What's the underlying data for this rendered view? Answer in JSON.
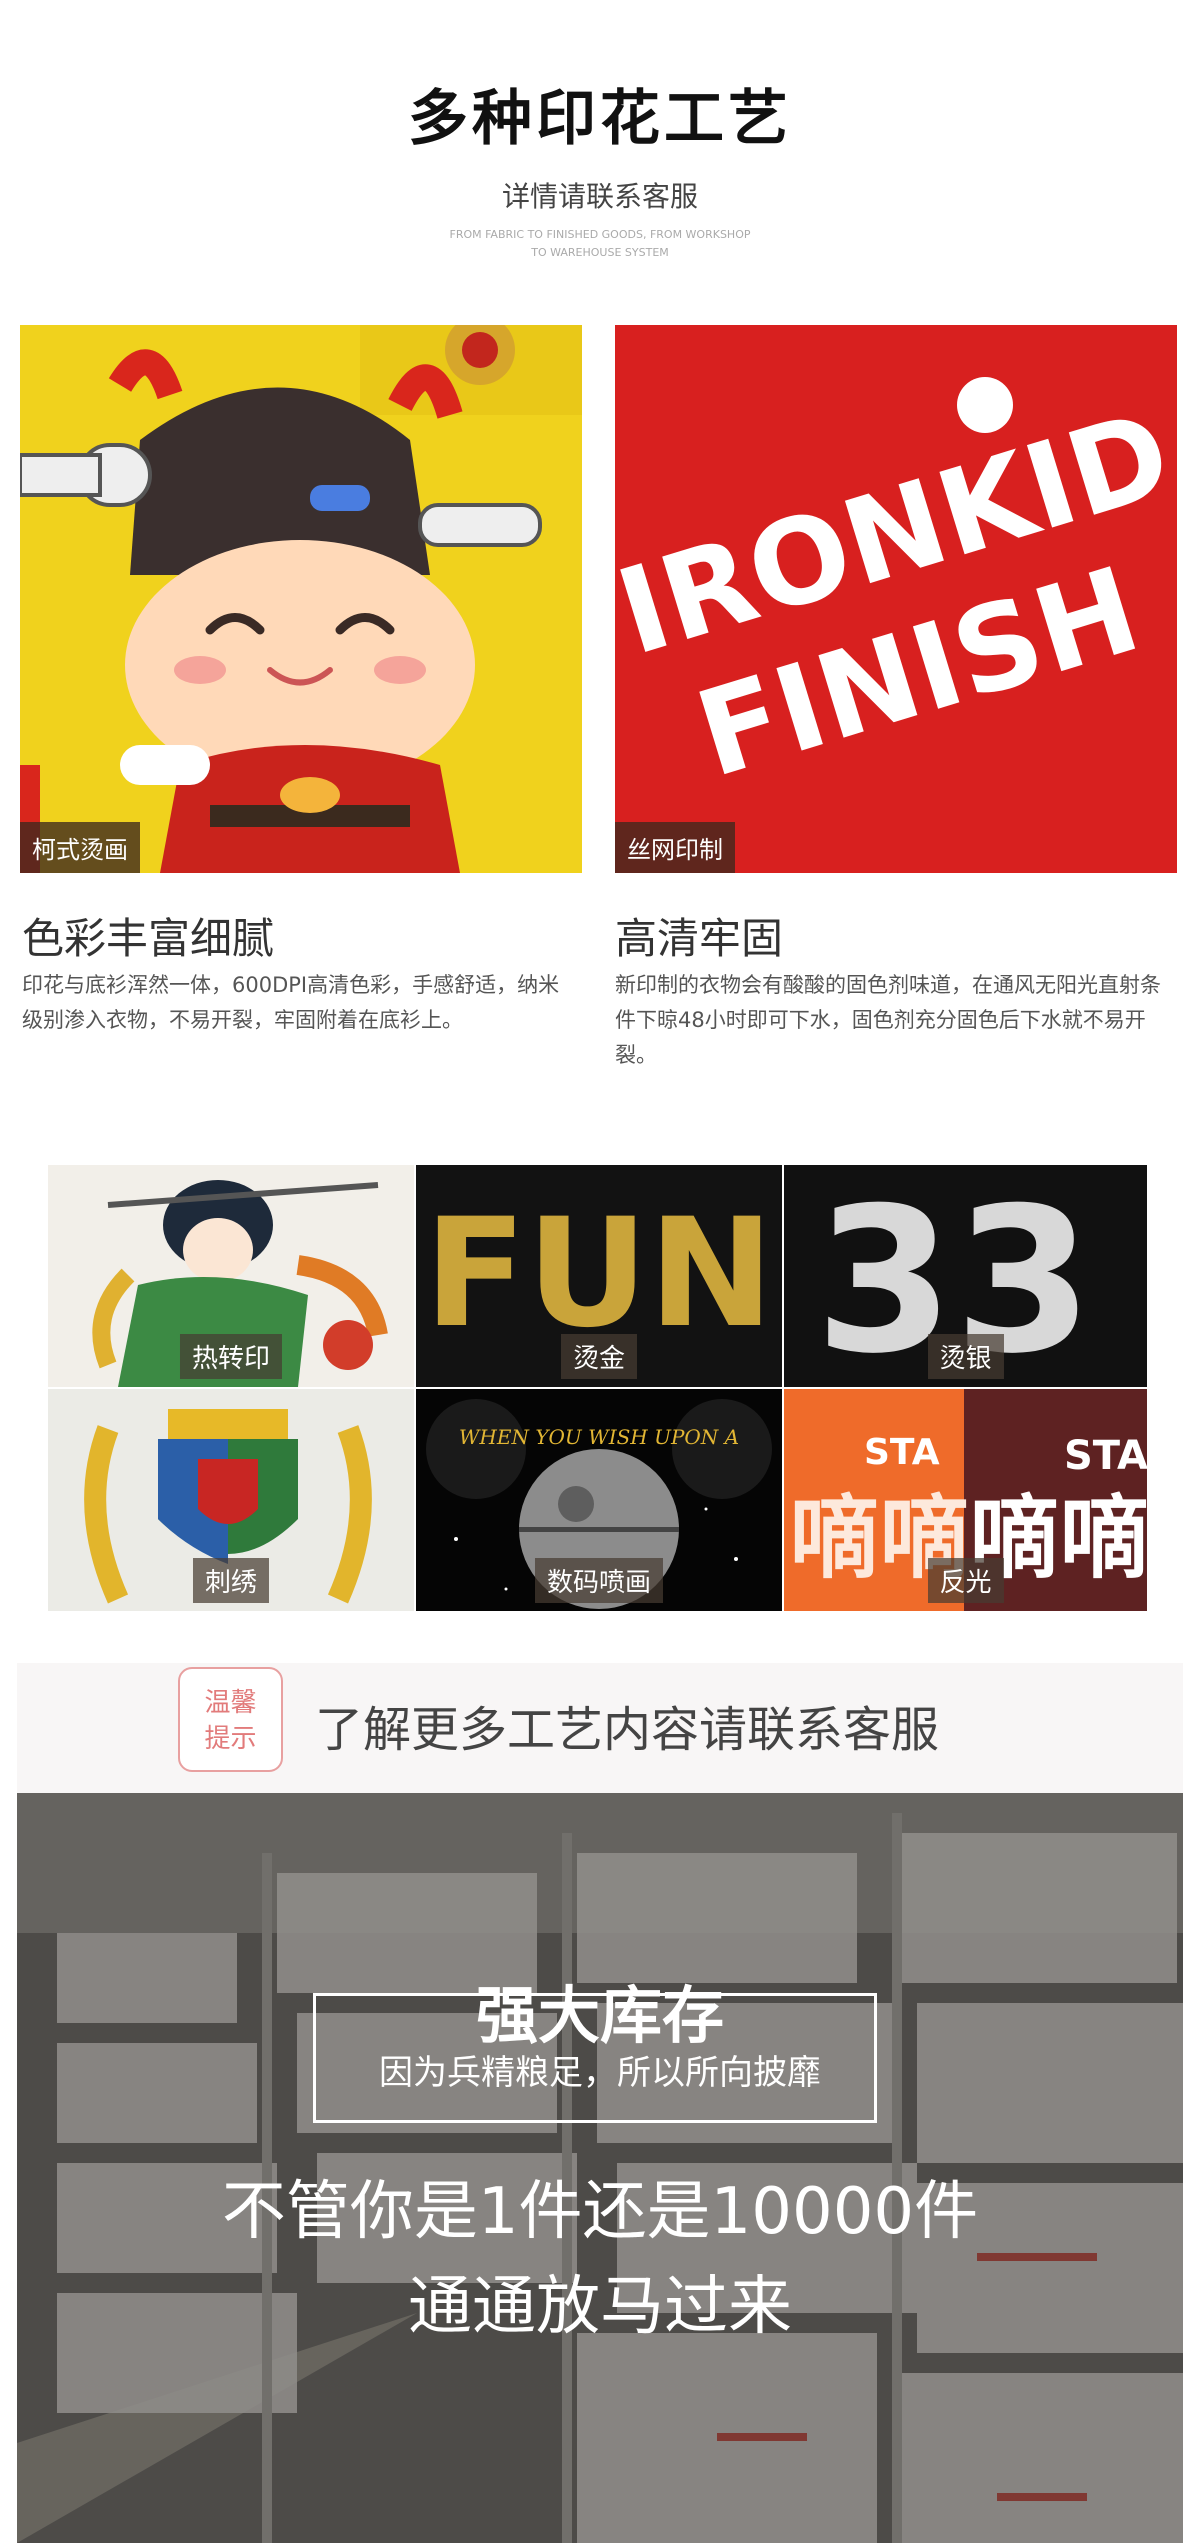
{
  "header": {
    "title": "多种印花工艺",
    "subtitle": "详情请联系客服",
    "fineprint_line1": "FROM FABRIC TO FINISHED GOODS, FROM WORKSHOP",
    "fineprint_line2": "TO WAREHOUSE SYSTEM"
  },
  "features": [
    {
      "tag": "柯式烫画",
      "heading": "色彩丰富细腻",
      "description": "印花与底衫浑然一体，600DPI高清色彩，手感舒适，纳米级别渗入衣物，不易开裂，牢固附着在底衫上。"
    },
    {
      "tag": "丝网印制",
      "heading": "高清牢固",
      "description": "新印制的衣物会有酸酸的固色剂味道，在通风无阳光直射条件下晾48小时即可下水，固色剂充分固色后下水就不易开裂。",
      "image_text_line1": "IRONKID",
      "image_text_line2": "FINISH"
    }
  ],
  "techniques": [
    {
      "label": "热转印"
    },
    {
      "label": "烫金",
      "image_text": "FUN"
    },
    {
      "label": "烫银",
      "image_text": "33"
    },
    {
      "label": "刺绣"
    },
    {
      "label": "数码喷画",
      "image_text": "WHEN YOU WISH UPON A"
    },
    {
      "label": "反光",
      "image_text_a": "STA",
      "image_text_b": "嘀嘀"
    }
  ],
  "notice": {
    "badge_line1": "温馨",
    "badge_line2": "提示",
    "text": "了解更多工艺内容请联系客服"
  },
  "warehouse": {
    "title": "强大库存",
    "subtitle": "因为兵精粮足，所以所向披靡",
    "line1": "不管你是1件还是10000件",
    "line2": "通通放马过来"
  },
  "colors": {
    "accent_red": "#d8201f",
    "yellow": "#f1d21c",
    "gold": "#c9a43a",
    "badge_pink": "#e27b7b"
  }
}
